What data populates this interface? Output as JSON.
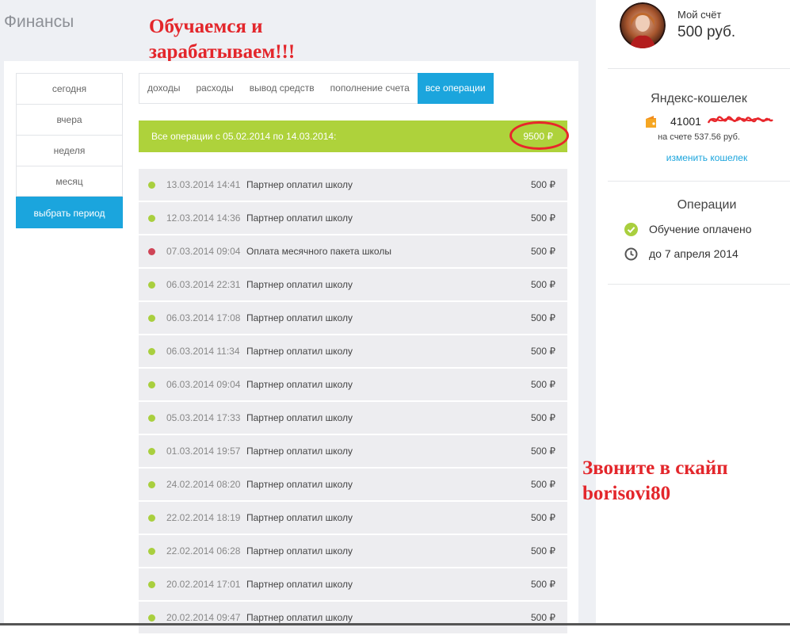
{
  "header": {
    "title": "Финансы",
    "promo_line1": "Обучаемся и",
    "promo_line2": "зарабатываем!!!"
  },
  "periods": [
    {
      "label": "сегодня",
      "active": false
    },
    {
      "label": "вчера",
      "active": false
    },
    {
      "label": "неделя",
      "active": false
    },
    {
      "label": "месяц",
      "active": false
    },
    {
      "label": "выбрать период",
      "active": true
    }
  ],
  "tabs": [
    {
      "label": "доходы",
      "active": false
    },
    {
      "label": "расходы",
      "active": false
    },
    {
      "label": "вывод средств",
      "active": false
    },
    {
      "label": "пополнение счета",
      "active": false
    },
    {
      "label": "все операции",
      "active": true
    }
  ],
  "summary": {
    "label": "Все операции с 05.02.2014 по 14.03.2014:",
    "amount": "9500 ₽"
  },
  "operations": [
    {
      "status": "income",
      "date": "13.03.2014 14:41",
      "desc": "Партнер оплатил школу",
      "amount": "500 ₽"
    },
    {
      "status": "income",
      "date": "12.03.2014 14:36",
      "desc": "Партнер оплатил школу",
      "amount": "500 ₽"
    },
    {
      "status": "expense",
      "date": "07.03.2014 09:04",
      "desc": "Оплата месячного пакета школы",
      "amount": "500 ₽"
    },
    {
      "status": "income",
      "date": "06.03.2014 22:31",
      "desc": "Партнер оплатил школу",
      "amount": "500 ₽"
    },
    {
      "status": "income",
      "date": "06.03.2014 17:08",
      "desc": "Партнер оплатил школу",
      "amount": "500 ₽"
    },
    {
      "status": "income",
      "date": "06.03.2014 11:34",
      "desc": "Партнер оплатил школу",
      "amount": "500 ₽"
    },
    {
      "status": "income",
      "date": "06.03.2014 09:04",
      "desc": "Партнер оплатил школу",
      "amount": "500 ₽"
    },
    {
      "status": "income",
      "date": "05.03.2014 17:33",
      "desc": "Партнер оплатил школу",
      "amount": "500 ₽"
    },
    {
      "status": "income",
      "date": "01.03.2014 19:57",
      "desc": "Партнер оплатил школу",
      "amount": "500 ₽"
    },
    {
      "status": "income",
      "date": "24.02.2014 08:20",
      "desc": "Партнер оплатил школу",
      "amount": "500 ₽"
    },
    {
      "status": "income",
      "date": "22.02.2014 18:19",
      "desc": "Партнер оплатил школу",
      "amount": "500 ₽"
    },
    {
      "status": "income",
      "date": "22.02.2014 06:28",
      "desc": "Партнер оплатил школу",
      "amount": "500 ₽"
    },
    {
      "status": "income",
      "date": "20.02.2014 17:01",
      "desc": "Партнер оплатил школу",
      "amount": "500 ₽"
    },
    {
      "status": "income",
      "date": "20.02.2014 09:47",
      "desc": "Партнер оплатил школу",
      "amount": "500 ₽"
    }
  ],
  "account": {
    "label": "Мой счёт",
    "value": "500 руб."
  },
  "wallet": {
    "title": "Яндекс-кошелек",
    "number": "41001",
    "balance": "на счете 537.56 руб.",
    "change_link": "изменить кошелек"
  },
  "operations_panel": {
    "title": "Операции",
    "items": [
      {
        "icon": "check-circle-icon",
        "text": "Обучение оплачено"
      },
      {
        "icon": "clock-icon",
        "text": "до 7 апреля 2014"
      }
    ]
  },
  "skype": {
    "line1": "Звоните в скайп",
    "line2": "borisovi80"
  },
  "colors": {
    "accent": "#1ba5dd",
    "summary_bg": "#aed23b",
    "income_dot": "#a9cf3e",
    "expense_dot": "#cf4456",
    "annotation_red": "#e3262b"
  }
}
